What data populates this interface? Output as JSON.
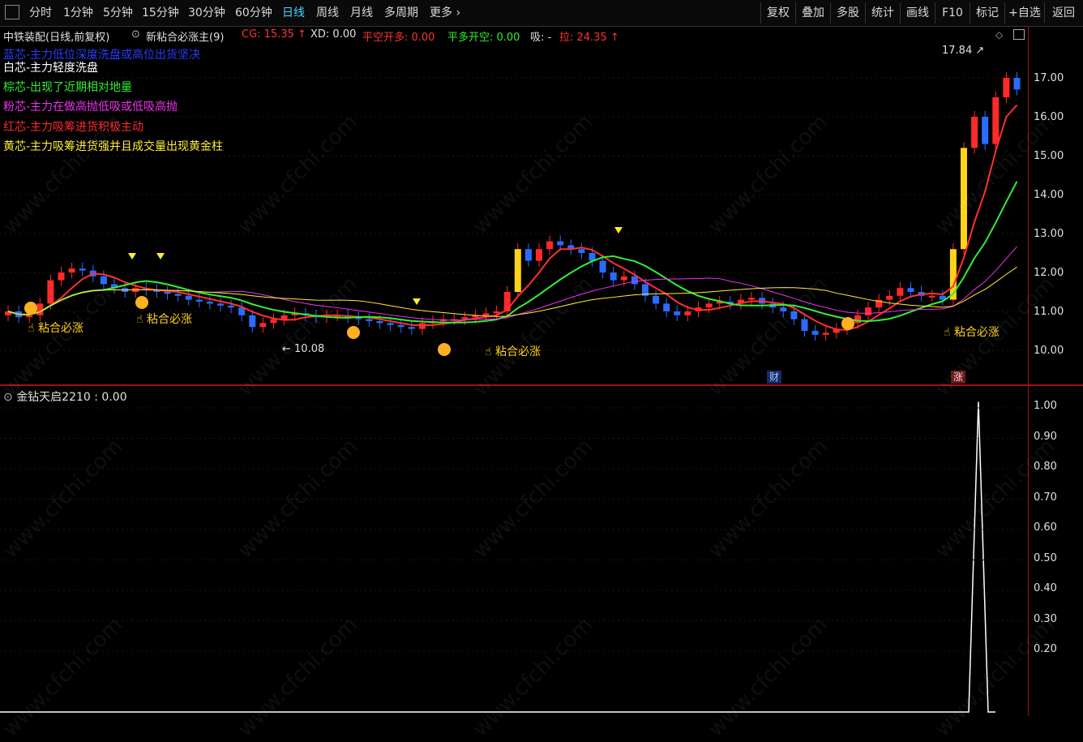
{
  "toolbar": {
    "left": [
      "分时",
      "1分钟",
      "5分钟",
      "15分钟",
      "30分钟",
      "60分钟",
      "日线",
      "周线",
      "月线",
      "多周期",
      "更多"
    ],
    "active": "日线",
    "right": [
      "复权",
      "叠加",
      "多股",
      "统计",
      "画线",
      "F10",
      "标记",
      "+自选",
      "返回"
    ]
  },
  "header": {
    "stock": "中铁装配(日线,前复权)",
    "indicator": "新粘合必涨主(9)",
    "cg": "CG: 15.35",
    "xd": "XD: 0.00",
    "pkd": "平空开多: 0.00",
    "pdk": "平多开空: 0.00",
    "xi": "吸: -",
    "la": "拉: 24.35"
  },
  "legend": [
    {
      "text": "蓝芯-主力低位深度洗盘或高位出货坚决",
      "color": "#2a3cff"
    },
    {
      "text": "白芯-主力轻度洗盘",
      "color": "#ffffff"
    },
    {
      "text": "棕芯-出现了近期相对地量",
      "color": "#33ee33"
    },
    {
      "text": "粉芯-主力在做高抛低吸或低吸高抛",
      "color": "#ee33ee"
    },
    {
      "text": "红芯-主力吸筹进货积极主动",
      "color": "#ff2a2a"
    },
    {
      "text": "黄芯-主力吸筹进货强并且成交量出现黄金柱",
      "color": "#ffee33"
    }
  ],
  "annotations": {
    "signal": "粘合必涨",
    "low_price": "10.08",
    "high_price": "17.84",
    "badge_cai": "财",
    "badge_zhang": "涨"
  },
  "main_axis": [
    "17.00",
    "16.00",
    "15.00",
    "14.00",
    "13.00",
    "12.00",
    "11.00",
    "10.00"
  ],
  "sub_header": "金钻天启2210 : 0.00",
  "sub_axis": [
    "1.00",
    "0.90",
    "0.80",
    "0.70",
    "0.60",
    "0.50",
    "0.40",
    "0.30",
    "0.20"
  ],
  "watermark": "www.cfchi.com",
  "colors": {
    "up": "#ff2a2a",
    "down": "#2a6cff",
    "accent": "#4fd1ff",
    "axis": "#a01010",
    "signal": "#ffd21a"
  }
}
